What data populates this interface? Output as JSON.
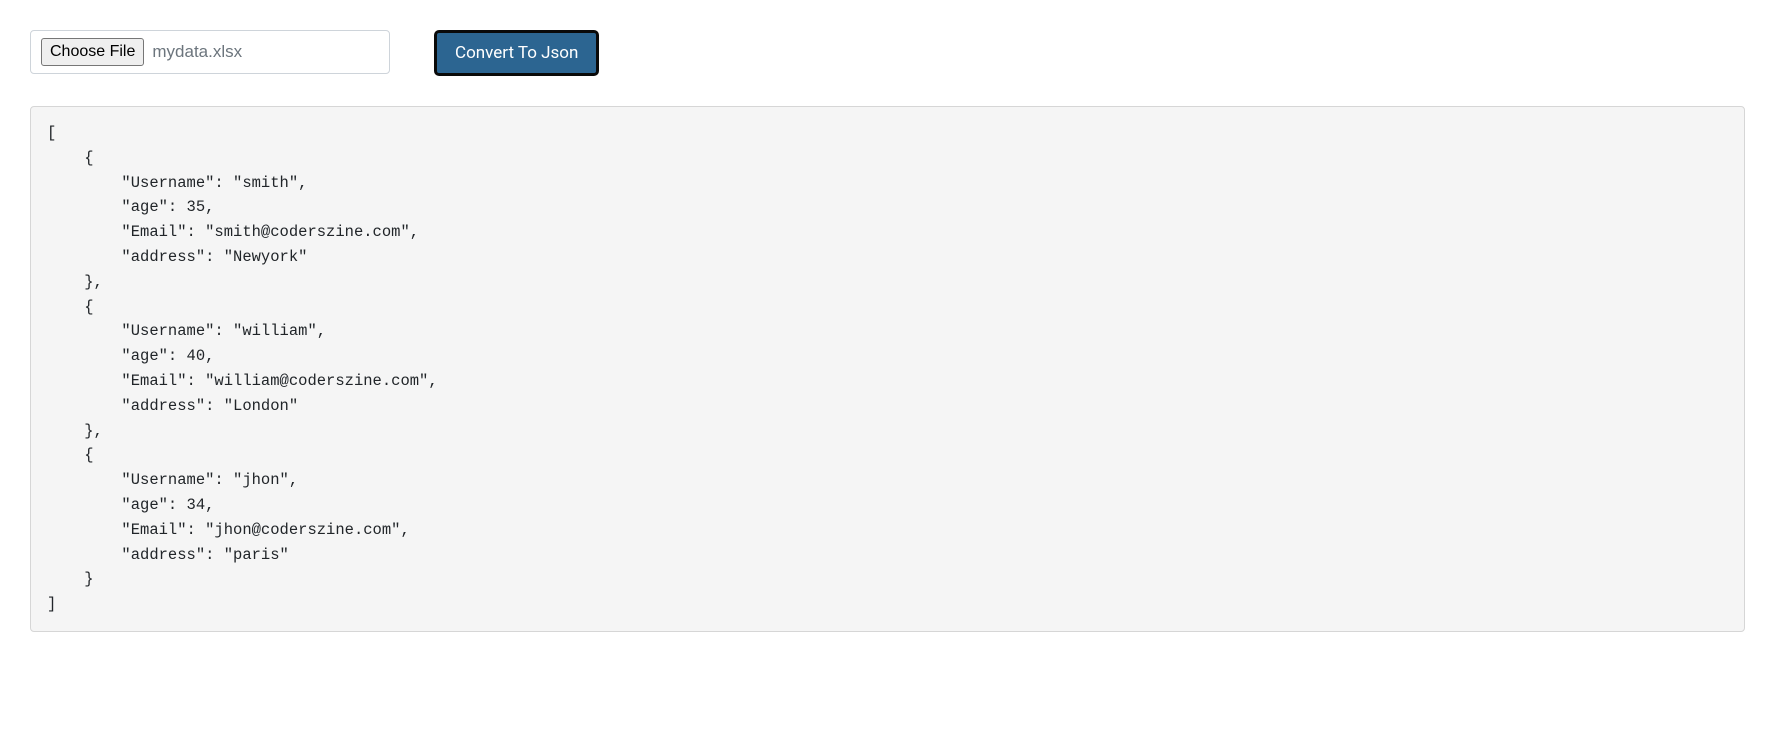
{
  "controls": {
    "choose_file_label": "Choose File",
    "selected_filename": "mydata.xlsx",
    "convert_button_label": "Convert To Json"
  },
  "output": {
    "json_text": "[\n    {\n        \"Username\": \"smith\",\n        \"age\": 35,\n        \"Email\": \"smith@coderszine.com\",\n        \"address\": \"Newyork\"\n    },\n    {\n        \"Username\": \"william\",\n        \"age\": 40,\n        \"Email\": \"william@coderszine.com\",\n        \"address\": \"London\"\n    },\n    {\n        \"Username\": \"jhon\",\n        \"age\": 34,\n        \"Email\": \"jhon@coderszine.com\",\n        \"address\": \"paris\"\n    }\n]",
    "records": [
      {
        "Username": "smith",
        "age": 35,
        "Email": "smith@coderszine.com",
        "address": "Newyork"
      },
      {
        "Username": "william",
        "age": 40,
        "Email": "william@coderszine.com",
        "address": "London"
      },
      {
        "Username": "jhon",
        "age": 34,
        "Email": "jhon@coderszine.com",
        "address": "paris"
      }
    ]
  }
}
